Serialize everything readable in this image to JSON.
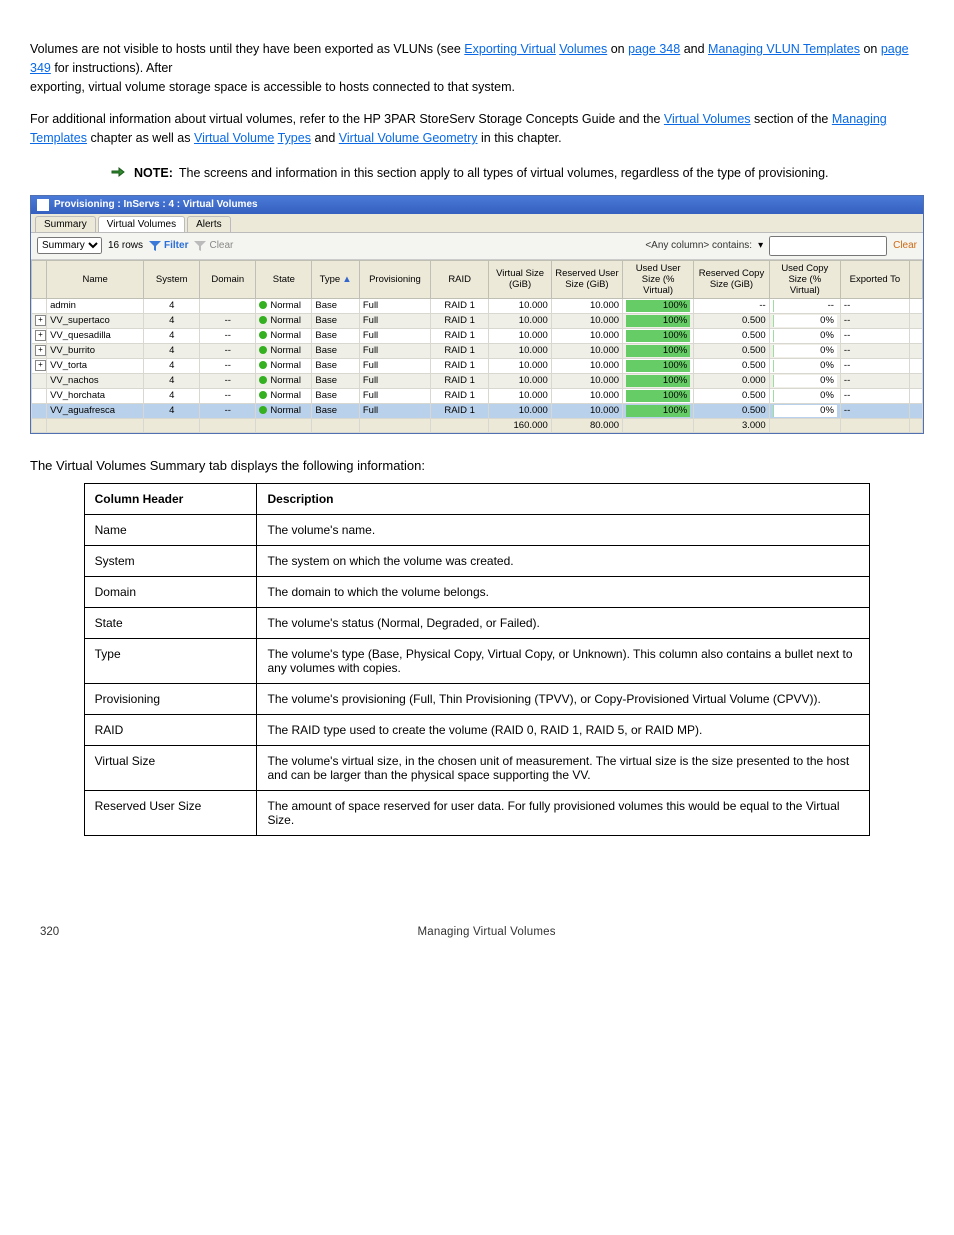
{
  "para1_pre": "Volumes are not visible to hosts until they have been exported as VLUNs (see ",
  "para1_link1_text": "Exporting Virtual",
  "para1_link2_text": "Volumes",
  "para1_mid1": " on ",
  "para1_link3_text": "page 348",
  "para1_mid2": " and ",
  "para1_link4_text": "Managing VLUN Templates",
  "para1_mid3": " on ",
  "para1_link5_text": "page 349",
  "para1_post": " for instructions). After",
  "para2": "exporting, virtual volume storage space is accessible to hosts connected to that system.",
  "para3_pre": "For additional information about virtual volumes, refer to the HP 3PAR StoreServ Storage Concepts Guide and the ",
  "para3_link1_text": "Virtual Volumes",
  "para3_mid1": " section of the ",
  "para3_link2_text": "Managing Templates",
  "para3_mid2": " chapter as well as ",
  "para3_link3_text": "Virtual Volume",
  "para3_link4_text": "Types",
  "para3_mid3": " and ",
  "para3_link5_text": "Virtual Volume Geometry",
  "para3_post": " in this chapter.",
  "note_label": "NOTE:",
  "note_text": "The screens and information in this section apply to all types of virtual volumes, regardless of the type of provisioning.",
  "app": {
    "title": "Provisioning : InServs : 4 : Virtual Volumes",
    "tabs": [
      "Summary",
      "Virtual Volumes",
      "Alerts"
    ],
    "view_select": "Summary",
    "rows_count": "16 rows",
    "filter_label": "Filter",
    "clear_label": "Clear",
    "contains_label": "<Any column> contains:",
    "clear_right": "Clear",
    "columns": [
      "",
      "Name",
      "System",
      "Domain",
      "State",
      "Type",
      "Provisioning",
      "RAID",
      "Virtual Size (GiB)",
      "Reserved User Size (GiB)",
      "Used User Size (% Virtual)",
      "Reserved Copy Size (GiB)",
      "Used Copy Size (% Virtual)",
      "Exported To"
    ],
    "rows": [
      {
        "expand": "",
        "name": "admin",
        "system": "4",
        "domain": "",
        "state": "Normal",
        "type": "Base",
        "prov": "Full",
        "raid": "RAID 1",
        "vsize": "10.000",
        "rsize": "10.000",
        "used": "100%",
        "rcopy": "--",
        "ucopy": "--",
        "exp": "--",
        "sel": false,
        "even": false
      },
      {
        "expand": "+",
        "name": "VV_supertaco",
        "system": "4",
        "domain": "--",
        "state": "Normal",
        "type": "Base",
        "prov": "Full",
        "raid": "RAID 1",
        "vsize": "10.000",
        "rsize": "10.000",
        "used": "100%",
        "rcopy": "0.500",
        "ucopy": "0%",
        "exp": "--",
        "sel": false,
        "even": true
      },
      {
        "expand": "+",
        "name": "VV_quesadilla",
        "system": "4",
        "domain": "--",
        "state": "Normal",
        "type": "Base",
        "prov": "Full",
        "raid": "RAID 1",
        "vsize": "10.000",
        "rsize": "10.000",
        "used": "100%",
        "rcopy": "0.500",
        "ucopy": "0%",
        "exp": "--",
        "sel": false,
        "even": false
      },
      {
        "expand": "+",
        "name": "VV_burrito",
        "system": "4",
        "domain": "--",
        "state": "Normal",
        "type": "Base",
        "prov": "Full",
        "raid": "RAID 1",
        "vsize": "10.000",
        "rsize": "10.000",
        "used": "100%",
        "rcopy": "0.500",
        "ucopy": "0%",
        "exp": "--",
        "sel": false,
        "even": true
      },
      {
        "expand": "+",
        "name": "VV_torta",
        "system": "4",
        "domain": "--",
        "state": "Normal",
        "type": "Base",
        "prov": "Full",
        "raid": "RAID 1",
        "vsize": "10.000",
        "rsize": "10.000",
        "used": "100%",
        "rcopy": "0.500",
        "ucopy": "0%",
        "exp": "--",
        "sel": false,
        "even": false
      },
      {
        "expand": "",
        "name": "VV_nachos",
        "system": "4",
        "domain": "--",
        "state": "Normal",
        "type": "Base",
        "prov": "Full",
        "raid": "RAID 1",
        "vsize": "10.000",
        "rsize": "10.000",
        "used": "100%",
        "rcopy": "0.000",
        "ucopy": "0%",
        "exp": "--",
        "sel": false,
        "even": true
      },
      {
        "expand": "",
        "name": "VV_horchata",
        "system": "4",
        "domain": "--",
        "state": "Normal",
        "type": "Base",
        "prov": "Full",
        "raid": "RAID 1",
        "vsize": "10.000",
        "rsize": "10.000",
        "used": "100%",
        "rcopy": "0.500",
        "ucopy": "0%",
        "exp": "--",
        "sel": false,
        "even": false
      },
      {
        "expand": "",
        "name": "VV_aguafresca",
        "system": "4",
        "domain": "--",
        "state": "Normal",
        "type": "Base",
        "prov": "Full",
        "raid": "RAID 1",
        "vsize": "10.000",
        "rsize": "10.000",
        "used": "100%",
        "rcopy": "0.500",
        "ucopy": "0%",
        "exp": "--",
        "sel": true,
        "even": true
      }
    ],
    "totals": {
      "vsize": "160.000",
      "rsize": "80.000",
      "rcopy": "3.000"
    }
  },
  "grid_caption": "The Virtual Volumes Summary tab displays the following information:",
  "grid": [
    {
      "h": "Column Header",
      "d": "Description"
    },
    {
      "h": "Name",
      "d": "The volume's name."
    },
    {
      "h": "System",
      "d": "The system on which the volume was created."
    },
    {
      "h": "Domain",
      "d": "The domain to which the volume belongs."
    },
    {
      "h": "State",
      "d": "The volume's status (Normal, Degraded, or Failed)."
    },
    {
      "h": "Type",
      "d": "The volume's type (Base, Physical Copy, Virtual Copy, or Unknown). This column also contains a bullet next to any volumes with copies."
    },
    {
      "h": "Provisioning",
      "d": "The volume's provisioning (Full, Thin Provisioning (TPVV), or Copy-Provisioned Virtual Volume (CPVV))."
    },
    {
      "h": "RAID",
      "d": "The RAID type used to create the volume (RAID 0, RAID 1, RAID 5, or RAID MP)."
    },
    {
      "h": "Virtual Size",
      "d": "The volume's virtual size, in the chosen unit of measurement. The virtual size is the size presented to the host and can be larger than the physical space supporting the VV."
    },
    {
      "h": "Reserved User Size",
      "d": "The amount of space reserved for user data. For fully provisioned volumes this would be equal to the Virtual Size."
    }
  ],
  "footer": {
    "left": "320",
    "mid": "Managing Virtual Volumes",
    "right": ""
  }
}
